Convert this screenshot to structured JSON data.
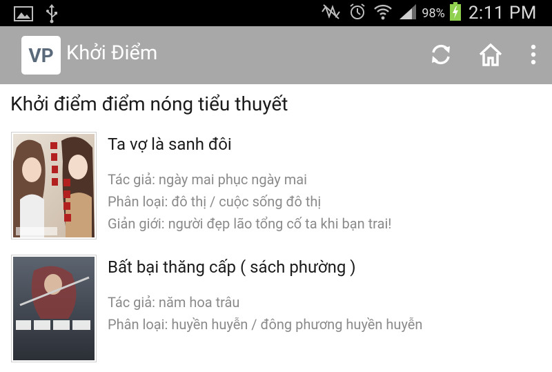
{
  "status_bar": {
    "icons": [
      "image-icon",
      "usb-icon",
      "mute-icon",
      "alarm-icon",
      "wifi-icon",
      "signal-icon",
      "battery-icon"
    ],
    "battery": "98%",
    "time": "2:11 PM"
  },
  "action_bar": {
    "logo": "VP",
    "title": "Khởi Điểm"
  },
  "section_heading": "Khởi điểm điểm nóng tiểu thuyết",
  "books": [
    {
      "title": "Ta vợ là sanh đôi",
      "author": "Tác giả: ngày mai phục ngày mai",
      "category": "Phân loại: đô thị / cuộc sống đô thị",
      "intro": "Giản giới: người đẹp lão tổng cố ta khi bạn trai!"
    },
    {
      "title": "Bất bại thăng cấp ( sách phường )",
      "author": "Tác giả: năm hoa trâu",
      "category": "Phân loại: huyền huyễn / đông phương huyền huyễn"
    }
  ]
}
